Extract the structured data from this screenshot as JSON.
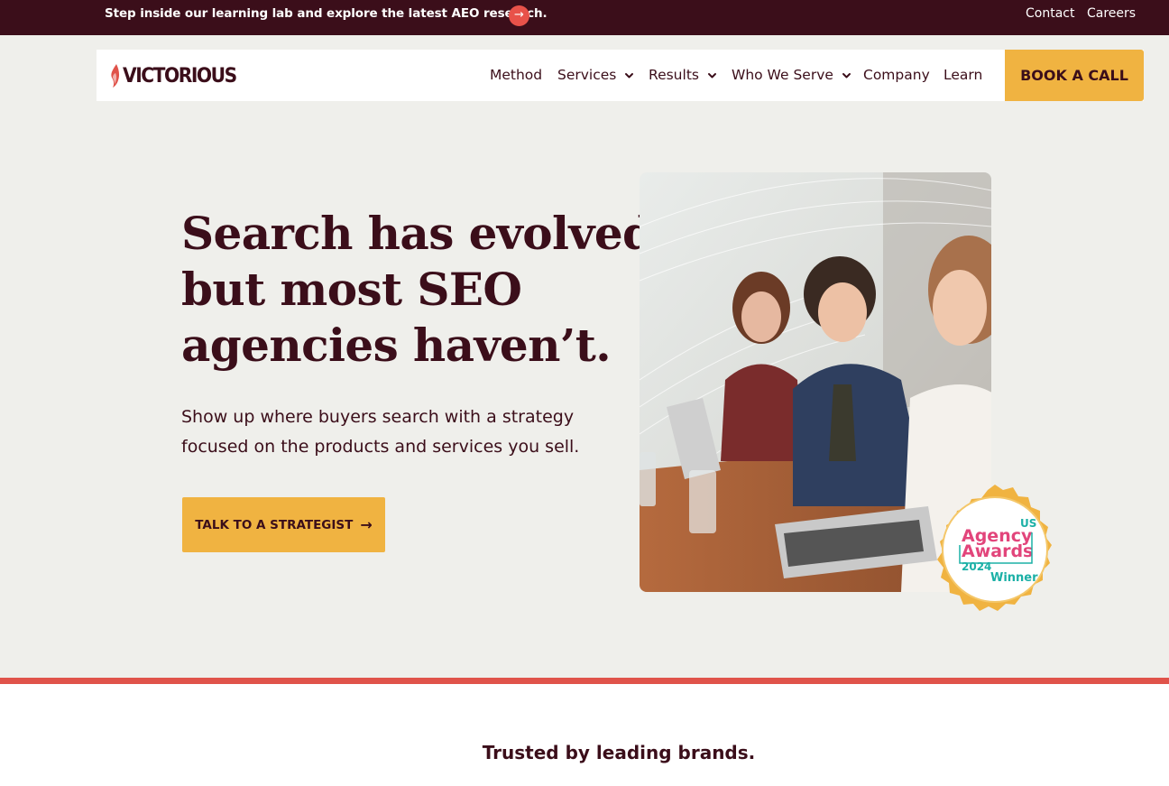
{
  "topbar": {
    "promo_text": "Step inside our learning lab and explore the latest AEO research.",
    "links": [
      "Contact",
      "Careers"
    ]
  },
  "nav": {
    "logo_text": "VICTORIOUS",
    "items": [
      {
        "label": "Method"
      },
      {
        "label": "Services"
      },
      {
        "label": "Results"
      },
      {
        "label": "Who We Serve"
      },
      {
        "label": "Company"
      },
      {
        "label": "Learn"
      }
    ],
    "cta_label": "BOOK A CALL"
  },
  "hero": {
    "title_lines": [
      "Search has evolved,",
      "but most SEO",
      "agencies haven’t."
    ],
    "subtitle_lines": [
      "Show up where buyers search with a strategy",
      "focused on the products and services you sell."
    ],
    "cta_label": "TALK TO A STRATEGIST"
  },
  "badge": {
    "line1": "US",
    "line2": "Agency",
    "line3": "Awards",
    "year": "2024",
    "winner": "Winner"
  },
  "trusted": {
    "heading": "Trusted by leading brands."
  },
  "colors": {
    "maroon": "#3b0e1a",
    "gold": "#f0b341",
    "coral": "#e0534a",
    "background": "#efefeb"
  }
}
